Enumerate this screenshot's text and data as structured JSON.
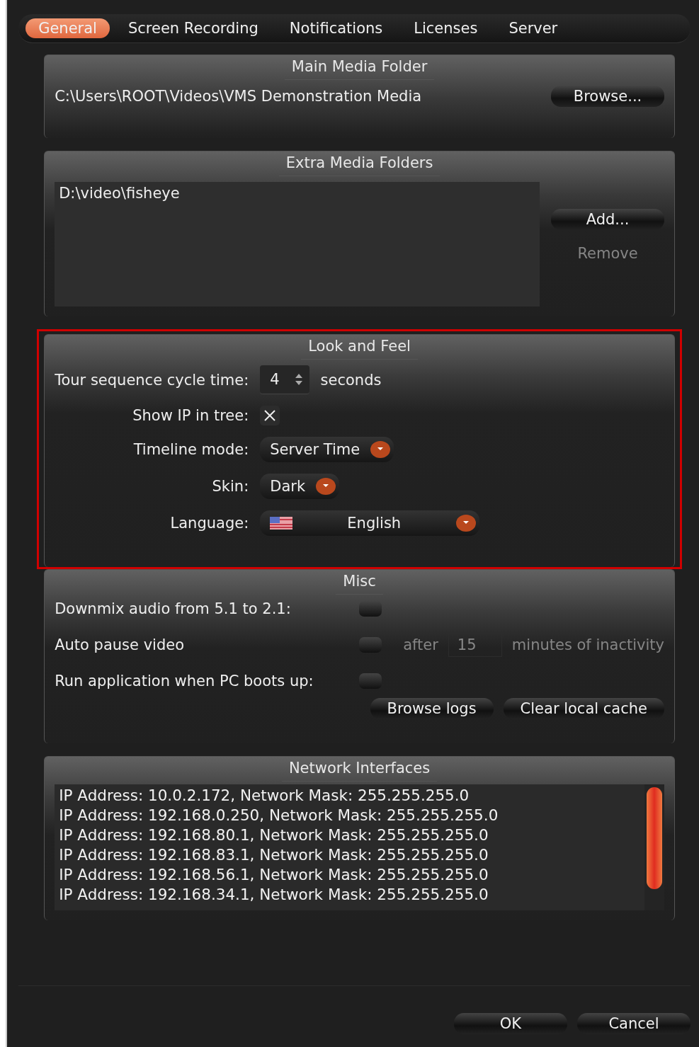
{
  "tabs": [
    {
      "label": "General",
      "selected": true
    },
    {
      "label": "Screen Recording",
      "selected": false
    },
    {
      "label": "Notifications",
      "selected": false
    },
    {
      "label": "Licenses",
      "selected": false
    },
    {
      "label": "Server",
      "selected": false
    }
  ],
  "main_media_folder": {
    "title": "Main Media Folder",
    "path": "C:\\Users\\ROOT\\Videos\\VMS Demonstration Media",
    "button": "Browse..."
  },
  "extra_media_folders": {
    "title": "Extra Media Folders",
    "items": [
      "D:\\video\\fisheye"
    ],
    "buttons": [
      {
        "label": "Add...",
        "disabled": false
      },
      {
        "label": "Remove",
        "disabled": true
      }
    ]
  },
  "look_and_feel": {
    "title": "Look and Feel",
    "highlighted": true,
    "rows": [
      {
        "kind": "spinner",
        "label": "Tour sequence cycle time:",
        "value": "4",
        "suffix": "seconds"
      },
      {
        "kind": "checkbox",
        "label": "Show IP in tree:",
        "checked": true
      },
      {
        "kind": "dropdown",
        "label": "Timeline mode:",
        "value": "Server Time"
      },
      {
        "kind": "dropdown",
        "label": "Skin:",
        "value": "Dark"
      },
      {
        "kind": "language",
        "label": "Language:",
        "value": "English"
      }
    ]
  },
  "misc": {
    "title": "Misc",
    "rows": [
      {
        "label": "Downmix audio from 5.1 to 2.1:",
        "checked": false
      },
      {
        "label": "Auto pause video",
        "checked": false,
        "after": "after",
        "minutes": "15",
        "suffix": "minutes of inactivity",
        "disabled": true
      },
      {
        "label": "Run application when PC boots up:",
        "checked": false
      }
    ],
    "buttons": [
      "Browse logs",
      "Clear local cache"
    ]
  },
  "network_interfaces": {
    "title": "Network Interfaces",
    "lines": [
      "IP Address: 10.0.2.172, Network Mask: 255.255.255.0",
      "IP Address: 192.168.0.250, Network Mask: 255.255.255.0",
      "IP Address: 192.168.80.1, Network Mask: 255.255.255.0",
      "IP Address: 192.168.83.1, Network Mask: 255.255.255.0",
      "IP Address: 192.168.56.1, Network Mask: 255.255.255.0",
      "IP Address: 192.168.34.1, Network Mask: 255.255.255.0"
    ]
  },
  "buttons": [
    "OK",
    "Cancel"
  ]
}
